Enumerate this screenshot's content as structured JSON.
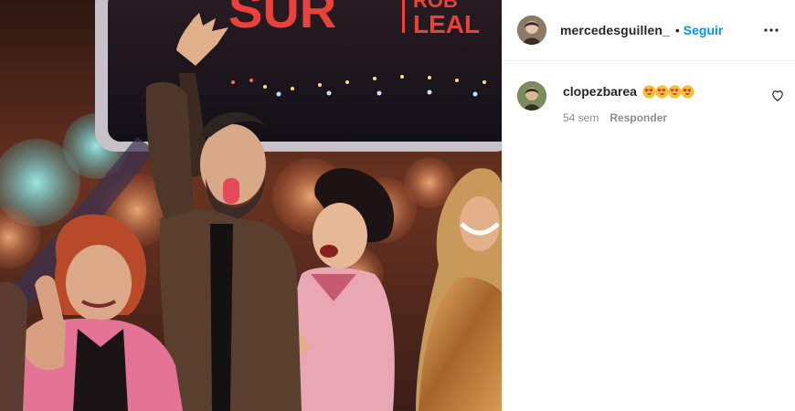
{
  "photo": {
    "sign_text_main": "SUR",
    "sign_text_side_top": "ROB",
    "sign_text_side_bottom": "LEAL"
  },
  "header": {
    "username": "mercedesguillen_",
    "separator": "•",
    "follow_label": "Seguir",
    "more_icon": "more-horizontal-icon"
  },
  "comments": [
    {
      "username": "clopezbarea",
      "emoji_icon": "heart-eyes-emoji-icon",
      "emoji_count": 4,
      "time": "54 sem",
      "reply_label": "Responder",
      "like_icon": "heart-outline-icon"
    }
  ],
  "colors": {
    "link": "#0095f6",
    "text": "#262626",
    "muted": "#8e8e8e",
    "divider": "#efefef"
  }
}
